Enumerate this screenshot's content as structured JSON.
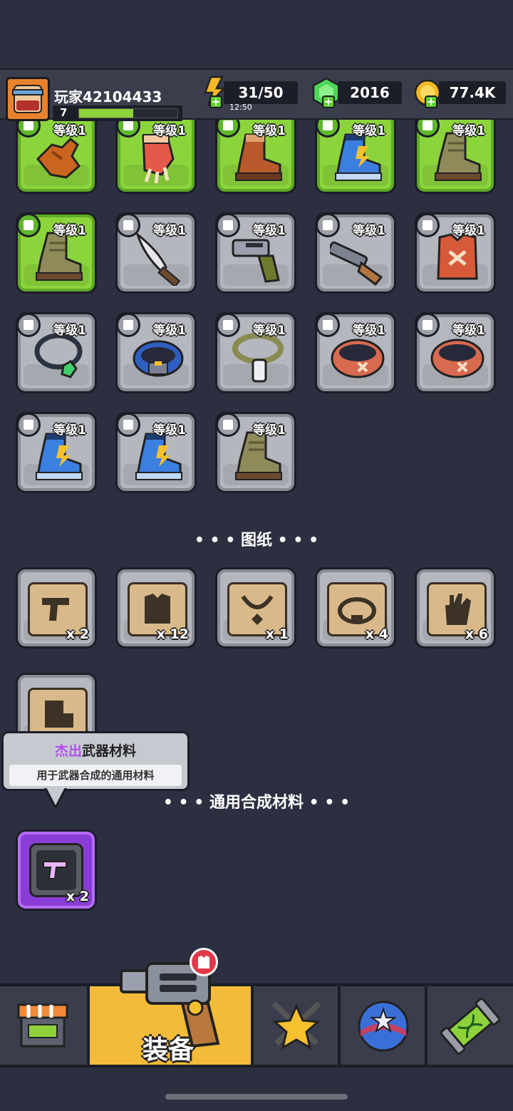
{
  "header": {
    "player_name": "玩家42104433",
    "player_level": "7",
    "xp_fraction": 0.55,
    "energy": "31/50",
    "energy_timer": "12:50",
    "gems": "2016",
    "gold": "77.4K"
  },
  "level_label": "等级1",
  "equipment": [
    {
      "item": "glove-icon",
      "rarity": "green",
      "type": "boots"
    },
    {
      "item": "claw-glove-icon",
      "rarity": "green",
      "type": "boots"
    },
    {
      "item": "brown-boot-icon",
      "rarity": "green",
      "type": "boots"
    },
    {
      "item": "blue-lightning-boot-icon",
      "rarity": "green",
      "type": "boots"
    },
    {
      "item": "military-boot-icon",
      "rarity": "green",
      "type": "boots"
    },
    {
      "item": "military-boot-icon",
      "rarity": "green",
      "type": "boots"
    },
    {
      "item": "machete-icon",
      "rarity": "grey",
      "type": "weapon"
    },
    {
      "item": "revolver-icon",
      "rarity": "grey",
      "type": "weapon"
    },
    {
      "item": "shotgun-icon",
      "rarity": "grey",
      "type": "weapon"
    },
    {
      "item": "leather-vest-icon",
      "rarity": "grey",
      "type": "armor"
    },
    {
      "item": "emerald-necklace-icon",
      "rarity": "grey",
      "type": "necklace"
    },
    {
      "item": "blue-belt-icon",
      "rarity": "grey",
      "type": "necklace"
    },
    {
      "item": "dogtag-necklace-icon",
      "rarity": "grey",
      "type": "necklace"
    },
    {
      "item": "fur-belt-icon",
      "rarity": "grey",
      "type": "belt"
    },
    {
      "item": "fur-belt-icon",
      "rarity": "grey",
      "type": "belt"
    },
    {
      "item": "blue-lightning-boot-icon",
      "rarity": "grey",
      "type": "boots"
    },
    {
      "item": "blue-lightning-boot-icon",
      "rarity": "grey",
      "type": "boots"
    },
    {
      "item": "military-boot-icon",
      "rarity": "grey",
      "type": "boots"
    }
  ],
  "blueprints_title": "• • •  图纸  • • •",
  "blueprints": [
    {
      "icon": "gun-blueprint-icon",
      "count": "x 2"
    },
    {
      "icon": "armor-blueprint-icon",
      "count": "x 12"
    },
    {
      "icon": "necklace-blueprint-icon",
      "count": "x 1"
    },
    {
      "icon": "belt-blueprint-icon",
      "count": "x 4"
    },
    {
      "icon": "glove-blueprint-icon",
      "count": "x 6"
    },
    {
      "icon": "boot-blueprint-icon",
      "count": ""
    }
  ],
  "tooltip": {
    "title_accent": "杰出",
    "title_rest": "武器材料",
    "description": "用于武器合成的通用材料"
  },
  "materials_title": "• • •  通用合成材料  • • •",
  "materials": [
    {
      "icon": "purple-weapon-material-icon",
      "count": "x 2"
    }
  ],
  "nav": {
    "equip_label": "装备"
  },
  "colors": {
    "background": "#2c2f3f",
    "green_slot": "#8cd43c",
    "grey_slot": "#b5b7bf",
    "purple_slot": "#8a3dd6",
    "active_tab": "#f4bb3a"
  }
}
